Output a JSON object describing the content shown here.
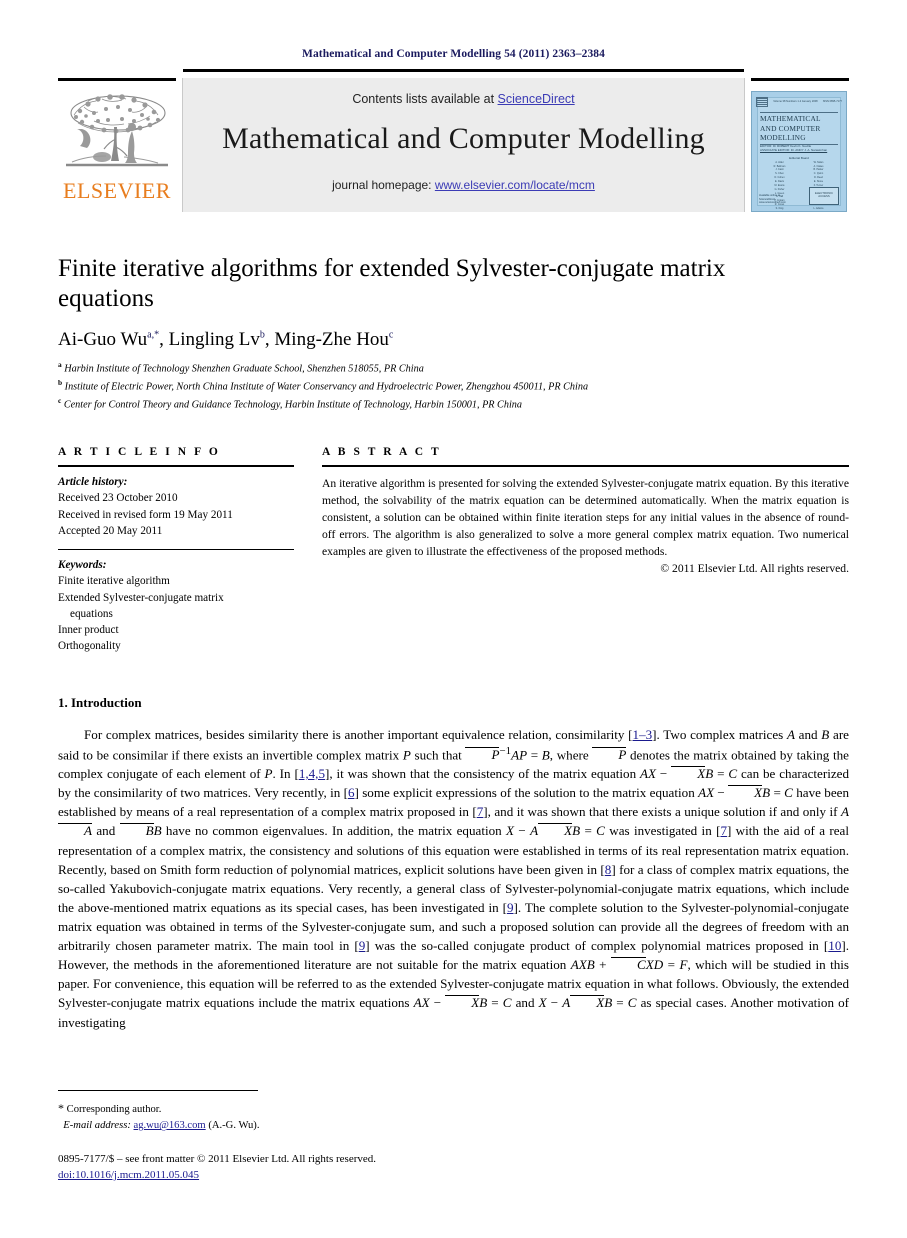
{
  "running_head": "Mathematical and Computer Modelling 54 (2011) 2363–2384",
  "masthead": {
    "contents_prefix": "Contents lists available at ",
    "sciencedirect": "ScienceDirect",
    "journal_title": "Mathematical and Computer Modelling",
    "homepage_prefix": "journal homepage: ",
    "homepage_url": "www.elsevier.com/locate/mcm",
    "publisher_wordmark": "ELSEVIER",
    "link_color": "#3b3bb5",
    "band_color": "#ececec",
    "elsevier_orange": "#e87d1e"
  },
  "cover": {
    "issue_line": "Volume 38 Numbers 1-2  January 2008",
    "issn_line": "ISSN 0895-7177",
    "title_line1": "MATHEMATICAL",
    "title_line2": "AND COMPUTER",
    "title_line3": "MODELLING",
    "editor_line1": "EDITOR: Dr ROBERT Kevin K. Neville",
    "editor_line2": "ASSOCIATE EDITOR: Dr. ANDY J. A. Narasimhan",
    "board_heading": "Editorial Board",
    "sd_line1": "Available online at",
    "sd_line2": "ScienceDirect",
    "sd_line3": "www.sciencedirect.com",
    "badge_line1": "ELECTRONIC",
    "badge_line2": "ACCESS",
    "bg_color": "#a9cfe8"
  },
  "paper": {
    "title": "Finite iterative algorithms for extended Sylvester-conjugate matrix equations",
    "authors": [
      {
        "name": "Ai-Guo Wu",
        "marks": "a,*"
      },
      {
        "name": "Lingling Lv",
        "marks": "b"
      },
      {
        "name": "Ming-Zhe Hou",
        "marks": "c"
      }
    ],
    "affiliations": [
      {
        "mark": "a",
        "text": "Harbin Institute of Technology Shenzhen Graduate School, Shenzhen 518055, PR China"
      },
      {
        "mark": "b",
        "text": "Institute of Electric Power, North China Institute of Water Conservancy and Hydroelectric Power, Zhengzhou 450011, PR China"
      },
      {
        "mark": "c",
        "text": "Center for Control Theory and Guidance Technology, Harbin Institute of Technology, Harbin 150001, PR China"
      }
    ]
  },
  "article_info": {
    "heading": "A R T I C L E    I N F O",
    "history_label": "Article history:",
    "history": [
      "Received 23 October 2010",
      "Received in revised form 19 May 2011",
      "Accepted 20 May 2011"
    ],
    "keywords_label": "Keywords:",
    "keywords": [
      "Finite iterative algorithm",
      "Extended Sylvester-conjugate matrix",
      "equations",
      "Inner product",
      "Orthogonality"
    ]
  },
  "abstract": {
    "heading": "A B S T R A C T",
    "text": "An iterative algorithm is presented for solving the extended Sylvester-conjugate matrix equation. By this iterative method, the solvability of the matrix equation can be determined automatically. When the matrix equation is consistent, a solution can be obtained within finite iteration steps for any initial values in the absence of round-off errors. The algorithm is also generalized to solve a more general complex matrix equation. Two numerical examples are given to illustrate the effectiveness of the proposed methods.",
    "copyright": "© 2011 Elsevier Ltd. All rights reserved."
  },
  "introduction": {
    "heading": "1. Introduction",
    "paragraph_parts": {
      "p1": "For complex matrices, besides similarity there is another important equivalence relation, consimilarity [",
      "r1": "1–3",
      "p2": "]. Two complex matrices ",
      "p3": " and ",
      "p4": " are said to be consimilar if there exists an invertible complex matrix ",
      "p5": " such that ",
      "p6": " denotes the matrix obtained by taking the complex conjugate of each element of ",
      "p7": ". In [",
      "r2": "1,4,5",
      "p8": "], it was shown that the consistency of the matrix equation ",
      "p9": " can be characterized by the consimilarity of two matrices. Very recently, in [",
      "r3": "6",
      "p10": "] some explicit expressions of the solution to the matrix equation ",
      "p11": " have been established by means of a real representation of a complex matrix proposed in [",
      "r4": "7",
      "p12": "], and it was shown that there exists a unique solution if and only if ",
      "p13": " have no common eigenvalues. In addition, the matrix equation ",
      "p14": " was investigated in [",
      "r5": "7",
      "p15": "] with the aid of a real representation of a complex matrix, the consistency and solutions of this equation were established in terms of its real representation matrix equation. Recently, based on Smith form reduction of polynomial matrices, explicit solutions have been given in [",
      "r6": "8",
      "p16": "] for a class of complex matrix equations, the so-called Yakubovich-conjugate matrix equations. Very recently, a general class of Sylvester-polynomial-conjugate matrix equations, which include the above-mentioned matrix equations as its special cases, has been investigated in [",
      "r7": "9",
      "p17": "]. The complete solution to the Sylvester-polynomial-conjugate matrix equation was obtained in terms of the Sylvester-conjugate sum, and such a proposed solution can provide all the degrees of freedom with an arbitrarily chosen parameter matrix. The main tool in [",
      "r8": "9",
      "p18": "] was the so-called conjugate product of complex polynomial matrices proposed in [",
      "r9": "10",
      "p19": "]. However, the methods in the aforementioned literature are not suitable for the matrix equation ",
      "p20": ", which will be studied in this paper. For convenience, this equation will be referred to as the extended Sylvester-conjugate matrix equation in what follows. Obviously, the extended Sylvester-conjugate matrix equations include the matrix equations ",
      "p21": " and ",
      "p22": " as special cases. Another motivation of investigating"
    }
  },
  "footer": {
    "corresponding_star": "*",
    "corresponding_text": "Corresponding author.",
    "email_label": "E-mail address:",
    "email": "ag.wu@163.com",
    "email_attrib": "(A.-G. Wu).",
    "issn_line": "0895-7177/$ – see front matter © 2011 Elsevier Ltd. All rights reserved.",
    "doi_line": "doi:10.1016/j.mcm.2011.05.045"
  }
}
